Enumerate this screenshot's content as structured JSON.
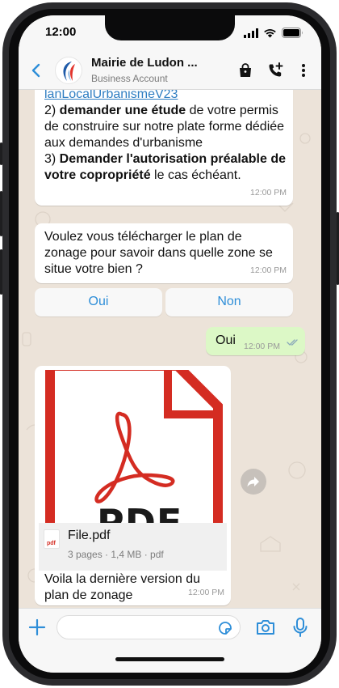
{
  "status": {
    "time": "12:00"
  },
  "header": {
    "contact_name": "Mairie de Ludon ...",
    "contact_sub": "Business Account"
  },
  "messages": {
    "m1": {
      "link": "lanLocalUrbanismeV23",
      "step2_num": "2) ",
      "step2_bold": "demander une étude",
      "step2_rest": " de votre permis de construire sur notre plate forme dédiée aux demandes d'urbanisme",
      "step3_num": "3) ",
      "step3_bold": "Demander l'autorisation préalable de votre copropriété",
      "step3_rest": " le cas échéant.",
      "time": "12:00 PM"
    },
    "m2": {
      "text": "Voulez vous télécharger le plan de zonage pour savoir dans quelle zone se situe votre bien ?",
      "time": "12:00 PM"
    },
    "quick_replies": [
      "Oui",
      "Non"
    ],
    "m3": {
      "text": "Oui",
      "time": "12:00 PM"
    },
    "m4": {
      "preview_text": "PDF",
      "file_name": "File.pdf",
      "file_meta": "3 pages · 1,4 MB · pdf",
      "file_icon_label": "pdf",
      "caption": "Voila la dernière version du plan de zonage",
      "time": "12:00 PM"
    }
  },
  "icons": {
    "back": "chevron-left-icon",
    "catalog": "shopping-bag-icon",
    "call": "add-call-icon",
    "menu": "more-vertical-icon",
    "forward": "forward-icon",
    "attach": "plus-icon",
    "sticker": "sticker-icon",
    "camera": "camera-icon",
    "mic": "microphone-icon"
  },
  "colors": {
    "accent": "#2e8ed8",
    "outgoing_bubble": "#dcf8c6",
    "incoming_bubble": "#ffffff",
    "chat_background": "#ece3d9",
    "pdf_red": "#d42c22"
  }
}
